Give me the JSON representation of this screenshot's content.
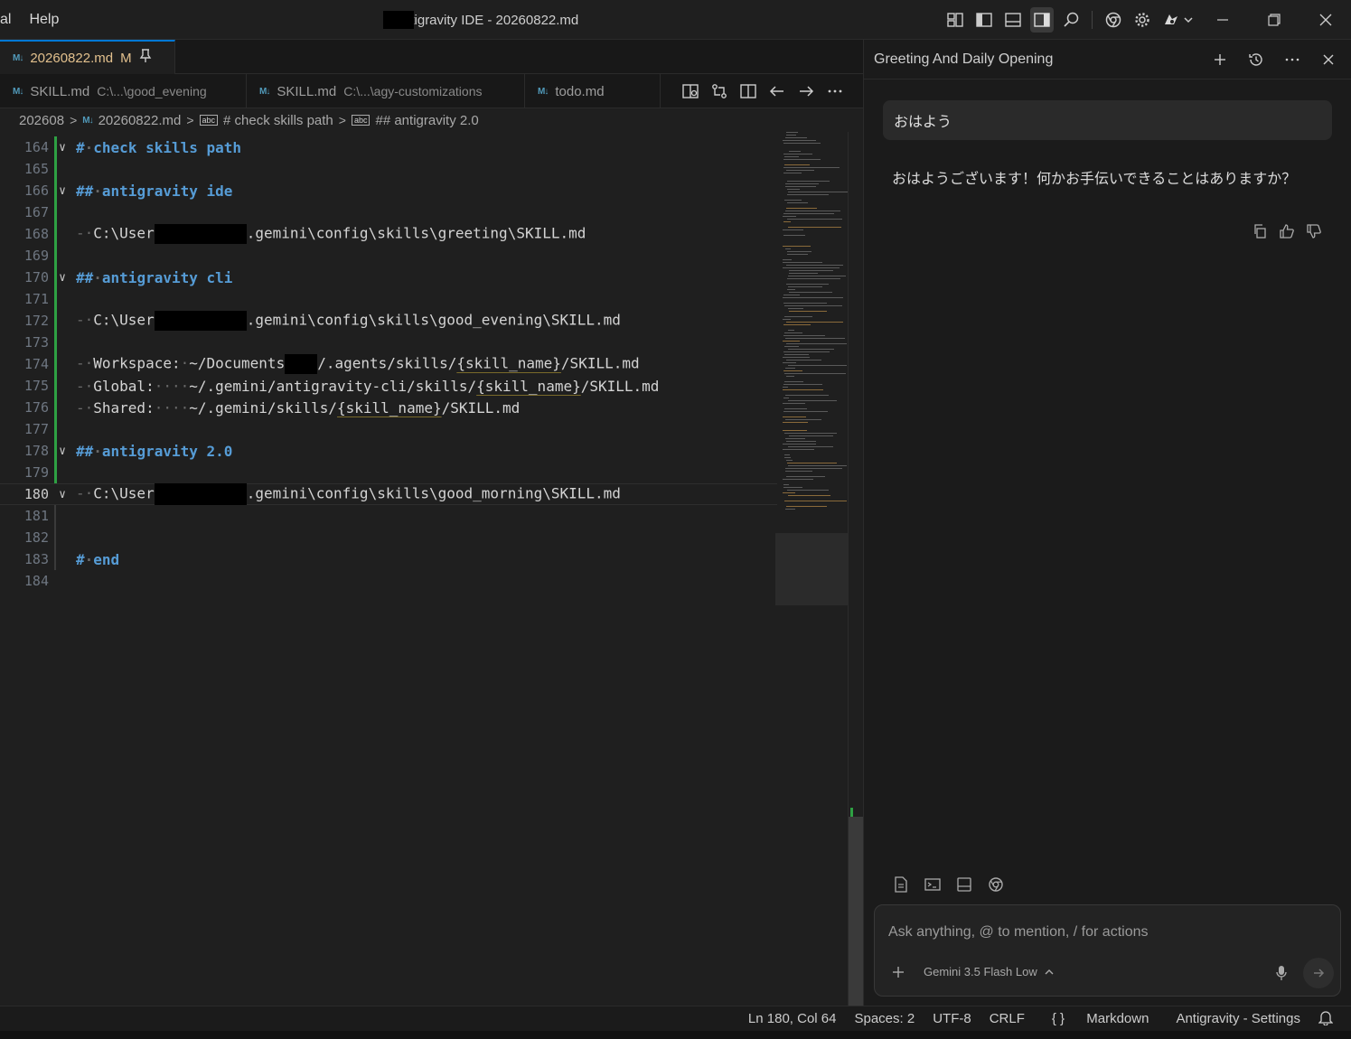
{
  "window": {
    "menu_items": [
      "al",
      "Help"
    ],
    "title": "Antigravity IDE - 20260822.md"
  },
  "editor": {
    "active_tab": {
      "name": "20260822.md",
      "status": "M"
    },
    "tabs": [
      {
        "name": "SKILL.md",
        "description": "C:\\...\\good_evening"
      },
      {
        "name": "SKILL.md",
        "description": "C:\\...\\agy-customizations"
      },
      {
        "name": "todo.md",
        "description": ""
      }
    ],
    "breadcrumb": [
      "202608",
      "20260822.md",
      "# check skills path",
      "## antigravity 2.0"
    ],
    "lines": {
      "l164": {
        "num": "164",
        "hash": "#",
        "text": "check skills path"
      },
      "l165": {
        "num": "165"
      },
      "l166": {
        "num": "166",
        "hash": "##",
        "text": "antigravity ide"
      },
      "l167": {
        "num": "167"
      },
      "l168": {
        "num": "168",
        "pre": "C:\\User",
        "post": ".gemini\\config\\skills\\greeting\\SKILL.md"
      },
      "l169": {
        "num": "169"
      },
      "l170": {
        "num": "170",
        "hash": "##",
        "text": "antigravity cli"
      },
      "l171": {
        "num": "171"
      },
      "l172": {
        "num": "172",
        "pre": "C:\\User",
        "post": ".gemini\\config\\skills\\good_evening\\SKILL.md"
      },
      "l173": {
        "num": "173"
      },
      "l174": {
        "num": "174",
        "label": "Workspace:",
        "pre": "~/Documents",
        "mid": "/.agents/skills/",
        "var": "{skill_name}",
        "post": "/SKILL.md"
      },
      "l175": {
        "num": "175",
        "label": "Global:",
        "pre": "~/.gemini/antigravity-cli/skills/",
        "var": "{skill_name}",
        "post": "/SKILL.md"
      },
      "l176": {
        "num": "176",
        "label": "Shared:",
        "pre": "~/.gemini/skills/",
        "var": "{skill_name}",
        "post": "/SKILL.md"
      },
      "l177": {
        "num": "177"
      },
      "l178": {
        "num": "178",
        "hash": "##",
        "text": "antigravity 2.0"
      },
      "l179": {
        "num": "179"
      },
      "l180": {
        "num": "180",
        "pre": "C:\\User",
        "post": ".gemini\\config\\skills\\good_morning\\SKILL.md"
      },
      "l181": {
        "num": "181"
      },
      "l182": {
        "num": "182"
      },
      "l183": {
        "num": "183",
        "hash": "#",
        "text": "end"
      },
      "l184": {
        "num": "184"
      }
    }
  },
  "agent_panel": {
    "title": "Greeting And Daily Opening",
    "user_message": "おはよう",
    "assistant_message": "おはようございます！何かお手伝いできることはありますか？",
    "input_placeholder": "Ask anything, @ to mention, / for actions",
    "model": "Gemini 3.5 Flash Low"
  },
  "statusbar": {
    "cursor": "Ln 180, Col 64",
    "spaces": "Spaces: 2",
    "encoding": "UTF-8",
    "eol": "CRLF",
    "language": "Markdown",
    "settings": "Antigravity - Settings"
  },
  "colors": {
    "accent": "#0078d4",
    "heading": "#569cd6",
    "modified": "#e2c08d",
    "git_added": "#2ea043"
  }
}
